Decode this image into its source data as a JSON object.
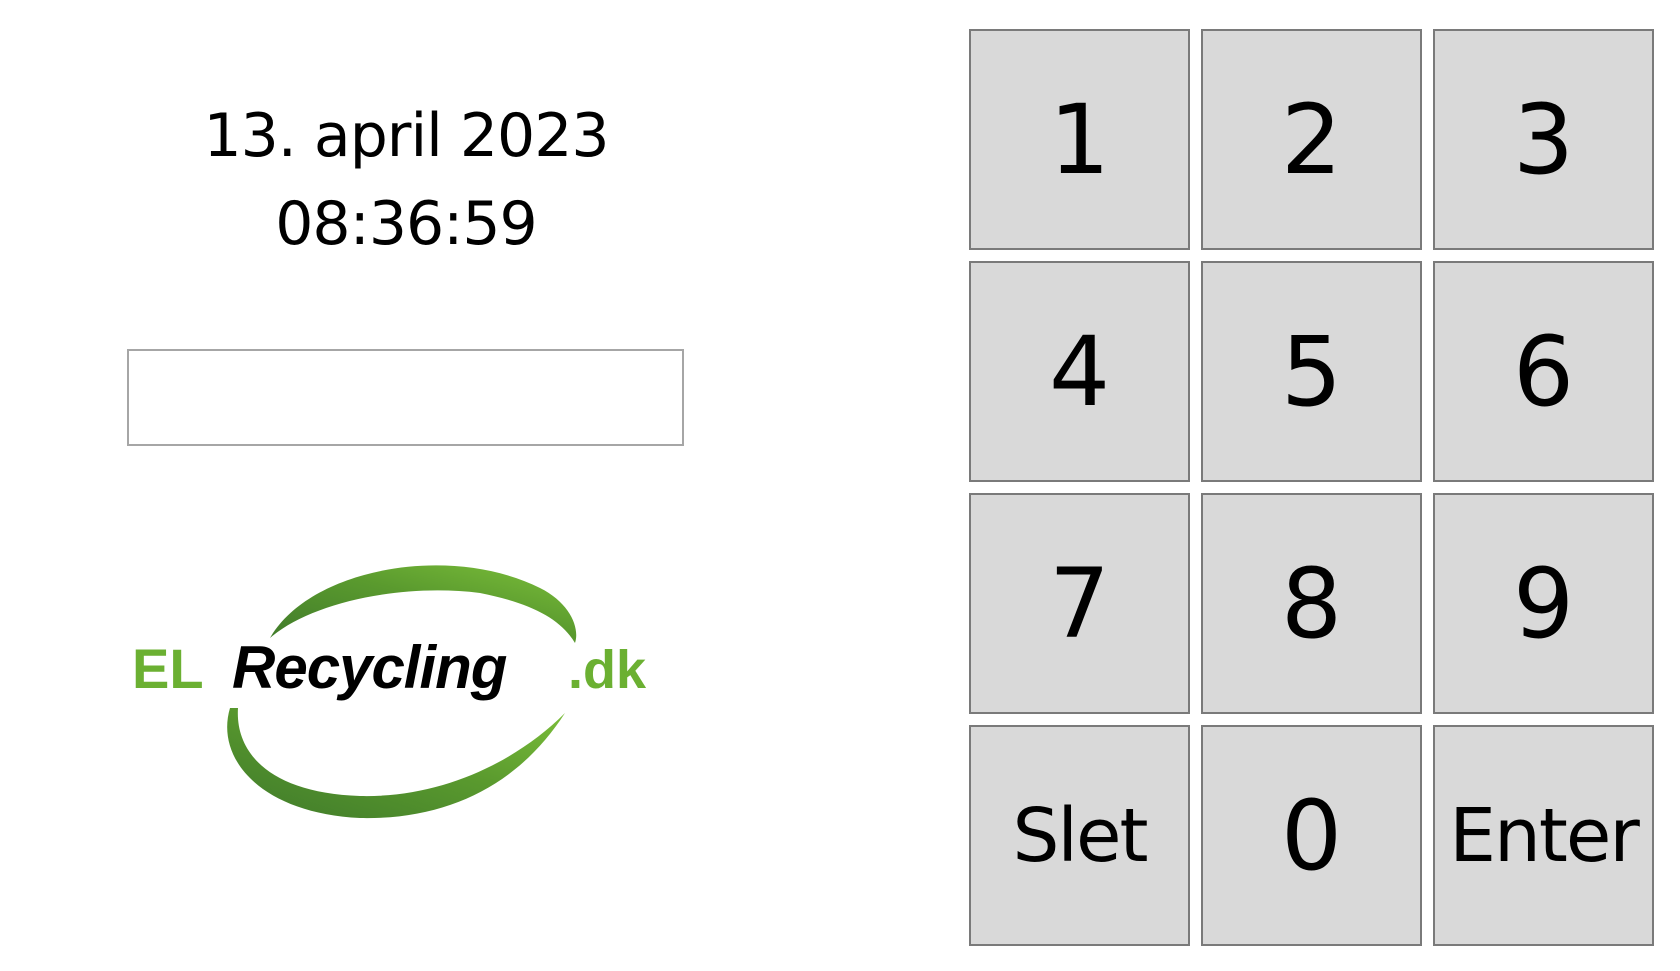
{
  "clock": {
    "date": "13. april 2023",
    "time": "08:36:59"
  },
  "code_input": {
    "value": "",
    "placeholder": ""
  },
  "logo": {
    "prefix": "EL",
    "name": "Recycling",
    "suffix": ".dk",
    "colors": {
      "green": "#6bb032",
      "dark_green": "#3f7a2a",
      "black": "#000000"
    }
  },
  "keypad": {
    "keys": [
      {
        "label": "1"
      },
      {
        "label": "2"
      },
      {
        "label": "3"
      },
      {
        "label": "4"
      },
      {
        "label": "5"
      },
      {
        "label": "6"
      },
      {
        "label": "7"
      },
      {
        "label": "8"
      },
      {
        "label": "9"
      },
      {
        "label": "Slet"
      },
      {
        "label": "0"
      },
      {
        "label": "Enter"
      }
    ]
  },
  "colors": {
    "background": "#ffffff",
    "key_fill": "#d9d9d9",
    "key_border": "#7a7a7a",
    "input_border": "#a6a6a6"
  }
}
